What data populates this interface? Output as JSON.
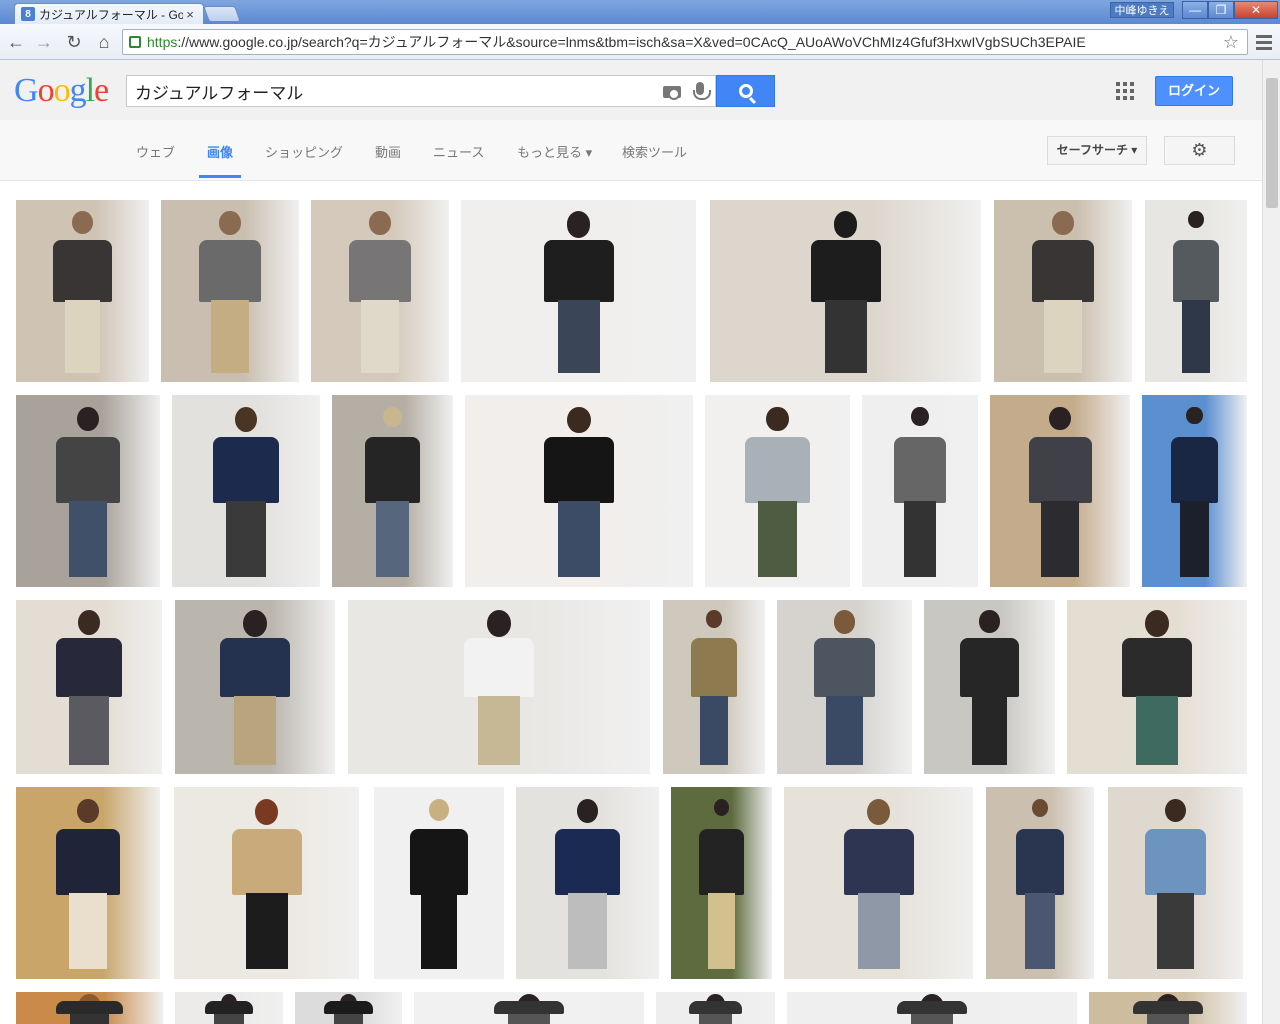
{
  "browser": {
    "tab_favicon": "8",
    "tab_title": "カジュアルフォーマル - Google",
    "tab_close": "×",
    "user_name": "中峰ゆきえ",
    "window_min": "—",
    "window_max": "❐",
    "window_close": "✕",
    "url_scheme": "https",
    "url_rest": "://www.google.co.jp/search?q=カジュアルフォーマル&source=lnms&tbm=isch&sa=X&ved=0CAcQ_AUoAWoVChMIz4Gfuf3HxwIVgbSUCh3EPAIE",
    "back_icon": "←",
    "forward_icon": "→",
    "reload_icon": "↻",
    "home_icon": "⌂",
    "star_icon": "☆"
  },
  "google": {
    "logo": [
      "G",
      "o",
      "o",
      "g",
      "l",
      "e"
    ],
    "search_query": "カジュアルフォーマル",
    "login_label": "ログイン",
    "nav_tabs": [
      "ウェブ",
      "画像",
      "ショッピング",
      "動画",
      "ニュース",
      "もっと見る ▾",
      "検索ツール"
    ],
    "active_tab": "画像",
    "safe_search_label": "セーフサーチ ▾",
    "gear_icon": "⚙"
  },
  "palette": {
    "accent": "#4285f4",
    "header_bg": "#f1f1f1"
  },
  "images": {
    "rows": [
      [
        {
          "bg": "#cfc3b4",
          "coat": "#3a3535",
          "pants": "#ddd4c0",
          "head": "#8a6a50"
        },
        {
          "bg": "#c9beaf",
          "coat": "#6a6a6a",
          "pants": "#c4ad82",
          "head": "#8a6a50"
        },
        {
          "bg": "#d4c9bb",
          "coat": "#777575",
          "pants": "#e0d8c8",
          "head": "#8a6a50"
        },
        {
          "bg": "#f1efed",
          "coat": "#1e1e1e",
          "pants": "#3a4558",
          "head": "#2a2222"
        },
        {
          "bg": "#dcd6cc",
          "coat": "#1d1d1d",
          "pants": "#333",
          "head": "#1c1c1c"
        },
        {
          "bg": "#cbbfae",
          "coat": "#3a3535",
          "pants": "#ddd4c0",
          "head": "#8a6a50"
        },
        {
          "bg": "#e8e6e2",
          "coat": "#555a5f",
          "pants": "#2e3848",
          "head": "#2a2222"
        }
      ],
      [
        {
          "bg": "#a8a29a",
          "coat": "#444",
          "pants": "#3f5068",
          "head": "#2a2222"
        },
        {
          "bg": "#e3e1de",
          "coat": "#1c2a4d",
          "pants": "#3a3a3a",
          "head": "#4a3424"
        },
        {
          "bg": "#b5aea4",
          "coat": "#252525",
          "pants": "#55667d",
          "head": "#c9b68f"
        },
        {
          "bg": "#f1eeec",
          "coat": "#151515",
          "pants": "#3c4c66",
          "head": "#3a2a20"
        },
        {
          "bg": "#f2f0ee",
          "coat": "#a8b0b8",
          "pants": "#4e5c42",
          "head": "#3a2a20"
        },
        {
          "bg": "#efefef",
          "coat": "#666",
          "pants": "#333",
          "head": "#2a2222"
        },
        {
          "bg": "#c4ab8c",
          "coat": "#3f4048",
          "pants": "#2b2b30",
          "head": "#2a2222"
        },
        {
          "bg": "#5a8fd0",
          "coat": "#1a2744",
          "pants": "#1c1f2c",
          "head": "#2a2222"
        }
      ],
      [
        {
          "bg": "#e3ddd3",
          "coat": "#27283a",
          "pants": "#5a5a60",
          "head": "#3a2a20"
        },
        {
          "bg": "#bab6ae",
          "coat": "#24314f",
          "pants": "#b9a47e",
          "head": "#2a2222"
        },
        {
          "bg": "#e9e7e4",
          "coat": "#f2f2f2",
          "pants": "#c7b895",
          "head": "#2a2222"
        },
        {
          "bg": "#cfc8bc",
          "coat": "#8d7a4e",
          "pants": "#3b4a64",
          "head": "#5a3a28"
        },
        {
          "bg": "#d6d3ce",
          "coat": "#4c5560",
          "pants": "#3b4a64",
          "head": "#7a5a3a"
        },
        {
          "bg": "#c9c7c2",
          "coat": "#262626",
          "pants": "#262626",
          "head": "#2a2222"
        },
        {
          "bg": "#e4ddd2",
          "coat": "#2b2b2b",
          "pants": "#3e6a60",
          "head": "#3a2a20"
        },
        {
          "bg": "#efede9",
          "coat": "#9c9c9e",
          "pants": "#333",
          "head": "#6a4a30"
        }
      ],
      [
        {
          "bg": "#c9a56a",
          "coat": "#1f2438",
          "pants": "#e9dfcc",
          "head": "#5a3a28"
        },
        {
          "bg": "#ece8e2",
          "coat": "#c9aa7a",
          "pants": "#1c1c1c",
          "head": "#7a3a22"
        },
        {
          "bg": "#f0f0f0",
          "coat": "#151515",
          "pants": "#151515",
          "head": "#c9b080"
        },
        {
          "bg": "#e4e2de",
          "coat": "#1b2a52",
          "pants": "#bdbdbd",
          "head": "#2a2222"
        },
        {
          "bg": "#5d6b3e",
          "coat": "#232323",
          "pants": "#d2c08f",
          "head": "#2a2222"
        },
        {
          "bg": "#e6e2da",
          "coat": "#2d3552",
          "pants": "#8f98a6",
          "head": "#7a5a3a"
        },
        {
          "bg": "#cbbfb0",
          "coat": "#2a3550",
          "pants": "#4b5670",
          "head": "#6a4a30"
        },
        {
          "bg": "#dfd8cf",
          "coat": "#6d93bf",
          "pants": "#3a3a3a",
          "head": "#3a2a20"
        }
      ],
      [
        {
          "bg": "#c98a4a",
          "coat": "#2a2a2a",
          "pants": "#333",
          "head": "#8a5a30"
        },
        {
          "bg": "#ecebea",
          "coat": "#222",
          "pants": "#444",
          "head": "#2a2222"
        },
        {
          "bg": "#dcdcdc",
          "coat": "#1b1b1b",
          "pants": "#444",
          "head": "#2a2222"
        },
        {
          "bg": "#f1f1f1",
          "coat": "#333",
          "pants": "#555",
          "head": "#2a2222"
        },
        {
          "bg": "#eeeeee",
          "coat": "#333",
          "pants": "#555",
          "head": "#2a2222"
        },
        {
          "bg": "#efefef",
          "coat": "#333",
          "pants": "#555",
          "head": "#2a2222"
        },
        {
          "bg": "#cdbd9e",
          "coat": "#333",
          "pants": "#555",
          "head": "#2a2222"
        },
        {
          "bg": "#efefef",
          "coat": "#333",
          "pants": "#555",
          "head": "#5a3a28"
        }
      ]
    ]
  }
}
